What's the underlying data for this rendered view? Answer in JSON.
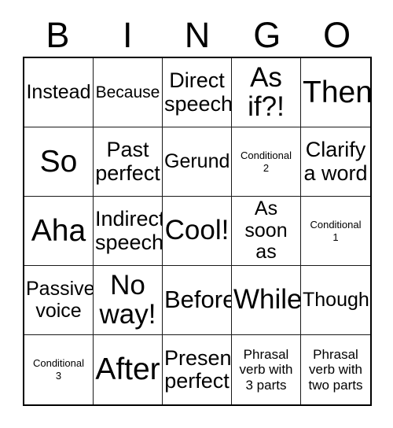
{
  "header": {
    "letters": [
      "B",
      "I",
      "N",
      "G",
      "O"
    ]
  },
  "grid": {
    "columns": 5,
    "rows": 5,
    "cells": [
      {
        "text": "Instead",
        "size": "fs-ml"
      },
      {
        "text": "Because",
        "size": "fs-m"
      },
      {
        "text": "Direct\nspeech",
        "size": "fs-l"
      },
      {
        "text": "As\nif?!",
        "size": "fs-xxl"
      },
      {
        "text": "Then",
        "size": "fs-xxxl"
      },
      {
        "text": "So",
        "size": "fs-xxxl"
      },
      {
        "text": "Past\nperfect",
        "size": "fs-l"
      },
      {
        "text": "Gerund",
        "size": "fs-ml"
      },
      {
        "text": "Conditional\n2",
        "size": "fs-xs"
      },
      {
        "text": "Clarify\na word",
        "size": "fs-l"
      },
      {
        "text": "Aha",
        "size": "fs-xxxl"
      },
      {
        "text": "Indirect\nspeech",
        "size": "fs-l"
      },
      {
        "text": "Cool!",
        "size": "fs-xxl"
      },
      {
        "text": "As\nsoon\nas",
        "size": "fs-ml"
      },
      {
        "text": "Conditional\n1",
        "size": "fs-xs"
      },
      {
        "text": "Passive\nvoice",
        "size": "fs-ml"
      },
      {
        "text": "No\nway!",
        "size": "fs-xxl"
      },
      {
        "text": "Before",
        "size": "fs-xl"
      },
      {
        "text": "While",
        "size": "fs-xxl"
      },
      {
        "text": "Though",
        "size": "fs-ml"
      },
      {
        "text": "Conditional\n3",
        "size": "fs-xs"
      },
      {
        "text": "After",
        "size": "fs-xxxl"
      },
      {
        "text": "Present\nperfect",
        "size": "fs-l"
      },
      {
        "text": "Phrasal\nverb with\n3 parts",
        "size": "fs-s"
      },
      {
        "text": "Phrasal\nverb with\ntwo parts",
        "size": "fs-s"
      }
    ]
  },
  "colors": {
    "background": "#ffffff",
    "text": "#000000",
    "outer_border": "#000000",
    "inner_border": "#1a1a1a"
  }
}
